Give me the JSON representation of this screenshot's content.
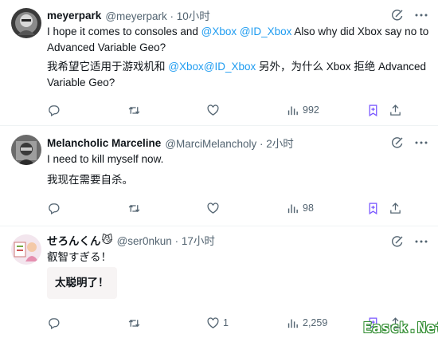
{
  "tweets": [
    {
      "name": "meyerpark",
      "handle": "@meyerpark · 10小时",
      "text_parts": [
        "I hope it comes to consoles and ",
        "@Xbox",
        " ",
        "@ID_Xbox",
        " Also why did Xbox say no to Advanced Variable Geo?"
      ],
      "translation_parts": [
        "我希望它适用于游戏机和 ",
        "@Xbox",
        "@ID_Xbox",
        " 另外，为什么 Xbox 拒绝 Advanced Variable Geo?"
      ],
      "views": "992",
      "likes": ""
    },
    {
      "name": "Melancholic Marceline",
      "handle": "@MarciMelancholy · 2小时",
      "text": "I need to kill myself now.",
      "translation": "我现在需要自杀。",
      "views": "98",
      "likes": ""
    },
    {
      "name": "せろんくん",
      "emoji": "😼",
      "handle": "@ser0nkun · 17小时",
      "text": "叡智すぎる！",
      "translation": "太聪明了！",
      "views": "2,259",
      "likes": "1"
    }
  ],
  "icons": {
    "reply": "reply-icon",
    "retweet": "retweet-icon",
    "like": "like-icon",
    "views": "views-icon",
    "bookmark": "bookmark-icon",
    "share": "share-icon",
    "grok": "grok-icon",
    "more": "more-icon"
  },
  "colors": {
    "accent": "#1d9bf0",
    "secondary_text": "#536471",
    "bookmark": "#7856ff"
  },
  "watermark": "Easck.Net"
}
